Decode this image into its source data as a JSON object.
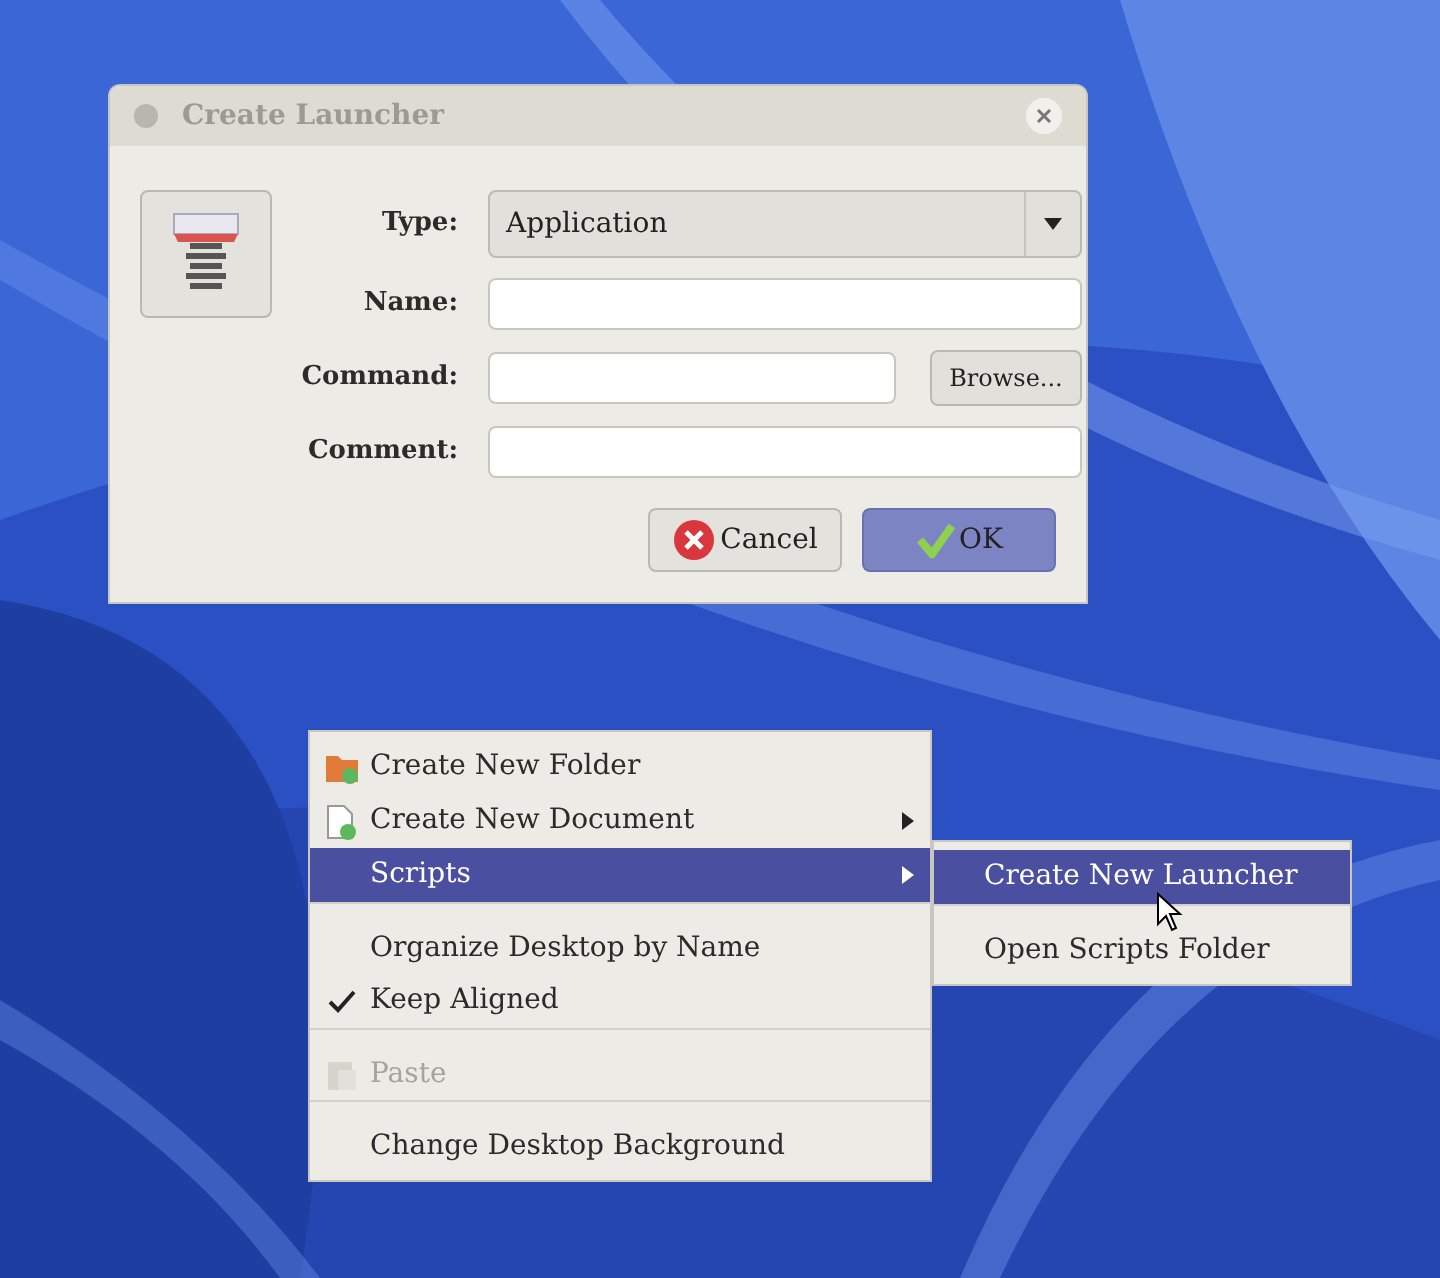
{
  "dialog": {
    "title": "Create Launcher",
    "type": {
      "label": "Type:",
      "value": "Application"
    },
    "fields": [
      {
        "label": "Name:"
      },
      {
        "label": "Command:",
        "browse": "Browse..."
      },
      {
        "label": "Comment:"
      }
    ],
    "buttons": [
      {
        "label": "Cancel",
        "kind": "cancel",
        "selected": false
      },
      {
        "label": "OK",
        "kind": "ok",
        "selected": true
      }
    ]
  },
  "context_menu": {
    "items": [
      {
        "label": "Create New Folder",
        "kind": "folder",
        "selected": false,
        "submenu": false,
        "checked": false,
        "disabled": false,
        "separator_before": false
      },
      {
        "label": "Create New Document",
        "kind": "document",
        "selected": false,
        "submenu": true,
        "checked": false,
        "disabled": false,
        "separator_before": false
      },
      {
        "label": "Scripts",
        "kind": "text",
        "selected": true,
        "submenu": true,
        "checked": false,
        "disabled": false,
        "separator_before": false
      },
      {
        "label": "Organize Desktop by Name",
        "kind": "text",
        "selected": false,
        "submenu": false,
        "checked": false,
        "disabled": false,
        "separator_before": true
      },
      {
        "label": "Keep Aligned",
        "kind": "text",
        "selected": false,
        "submenu": false,
        "checked": true,
        "disabled": false,
        "separator_before": false
      },
      {
        "label": "Paste",
        "kind": "clipboard",
        "selected": false,
        "submenu": false,
        "checked": false,
        "disabled": true,
        "separator_before": true
      },
      {
        "label": "Change Desktop Background",
        "kind": "text",
        "selected": false,
        "submenu": false,
        "checked": false,
        "disabled": false,
        "separator_before": true
      }
    ]
  },
  "submenu": {
    "items": [
      {
        "label": "Create New Launcher",
        "selected": true,
        "separator_before": false
      },
      {
        "label": "Open Scripts Folder",
        "selected": false,
        "separator_before": true
      }
    ]
  }
}
